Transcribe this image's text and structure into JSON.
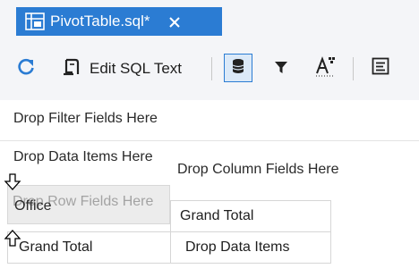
{
  "tab": {
    "title": "PivotTable.sql*",
    "icon": "pivot-table-icon",
    "close_icon": "close-icon",
    "color": "#2b7cd3"
  },
  "toolbar": {
    "refresh_icon": "refresh-icon",
    "edit_sql_label": "Edit SQL Text",
    "edit_sql_icon": "edit-sql-icon",
    "datasource_icon": "database-icon",
    "filter_icon": "filter-icon",
    "font_icon": "font-icon",
    "text_view_icon": "text-view-icon"
  },
  "pivot": {
    "filter_area": "Drop Filter Fields Here",
    "data_items_header": "Drop Data Items Here",
    "column_area": "Drop Column Fields Here",
    "row_area": "Drop Row Fields Here",
    "row_field": "Office",
    "grand_total_column": "Grand Total",
    "grand_total_row": "Grand Total",
    "data_area": "Drop Data Items"
  },
  "colors": {
    "accent": "#2b7cd3",
    "background": "#f4f5f8",
    "selected_button": "#dbe9f8"
  }
}
